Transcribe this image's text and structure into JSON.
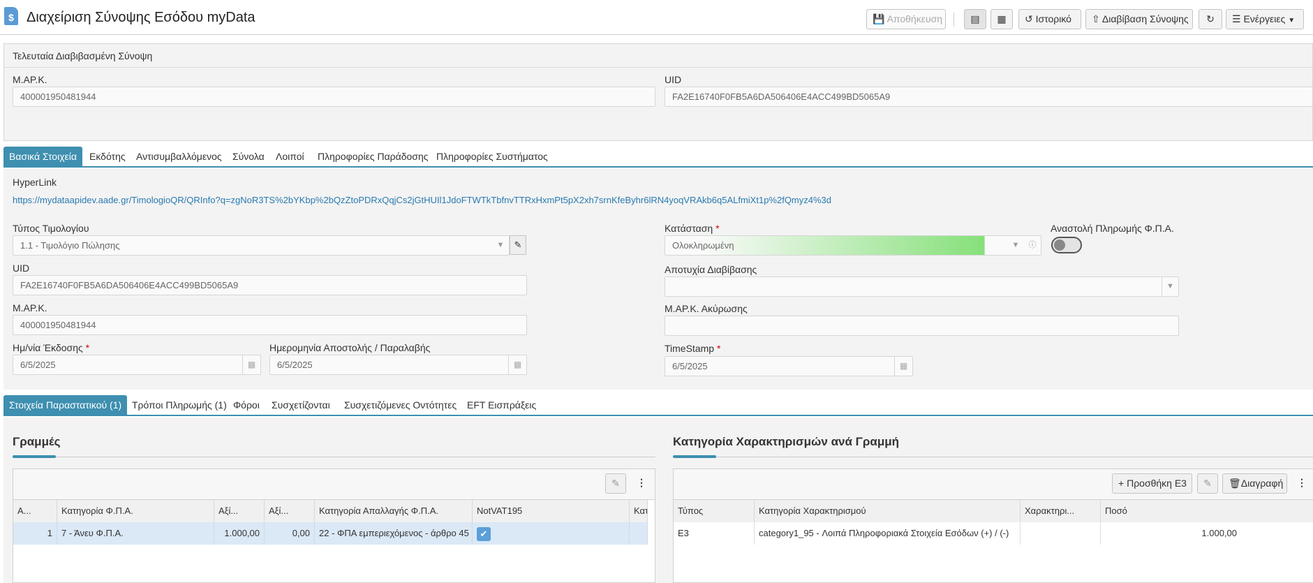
{
  "header": {
    "title": "Διαχείριση Σύνοψης Εσόδου myData",
    "doc_icon_glyph": "$",
    "save_label": "Αποθήκευση",
    "history_label": "Ιστορικό",
    "transmit_label": "Διαβίβαση Σύνοψης",
    "actions_label": "Ενέργειες"
  },
  "last_summary": {
    "title": "Τελευταία Διαβιβασμένη Σύνοψη",
    "mark_label": "Μ.ΑΡ.Κ.",
    "mark_value": "400001950481944",
    "uid_label": "UID",
    "uid_value": "FA2E16740F0FB5A6DA506406E4ACC499BD5065A9"
  },
  "main_tabs": [
    "Βασικά Στοιχεία",
    "Εκδότης",
    "Αντισυμβαλλόμενος",
    "Σύνολα",
    "Λοιποί",
    "Πληροφορίες Παράδοσης",
    "Πληροφορίες Συστήματος"
  ],
  "basic": {
    "hyperlink_label": "HyperLink",
    "hyperlink_value": "https://mydataapidev.aade.gr/TimologioQR/QRInfo?q=zgNoR3TS%2bYKbp%2bQzZtoPDRxQqjCs2jGtHUIl1JdoFTWTkTbfnvTTRxHxmPt5pX2xh7srnKfeByhr6lRN4yoqVRAkb6q5ALfmiXt1p%2fQmyz4%3d",
    "invoice_type_label": "Τύπος Τιμολογίου",
    "invoice_type_value": "1.1 - Τιμολόγιο Πώλησης",
    "status_label": "Κατάσταση",
    "status_value": "Ολοκληρωμένη",
    "vat_suspension_label": "Αναστολή Πληρωμής Φ.Π.Α.",
    "uid_label": "UID",
    "uid_value": "FA2E16740F0FB5A6DA506406E4ACC499BD5065A9",
    "transmit_failure_label": "Αποτυχία Διαβίβασης",
    "mark_label": "Μ.ΑΡ.Κ.",
    "mark_value": "400001950481944",
    "cancel_mark_label": "Μ.ΑΡ.Κ. Ακύρωσης",
    "issue_date_label": "Ημ/νία Έκδοσης",
    "issue_date_value": "6/5/2025",
    "dispatch_date_label": "Ημερομηνία Αποστολής / Παραλαβής",
    "dispatch_date_value": "6/5/2025",
    "timestamp_label": "TimeStamp",
    "timestamp_value": "6/5/2025",
    "required_mark": "*"
  },
  "sub_tabs": [
    "Στοιχεία Παραστατικού (1)",
    "Τρόποι Πληρωμής (1)",
    "Φόροι",
    "Συσχετίζονται",
    "Συσχετιζόμενες Οντότητες",
    "EFT Εισπράξεις"
  ],
  "lines": {
    "title": "Γραμμές",
    "columns": [
      "Α...",
      "Κατηγορία Φ.Π.Α.",
      "Αξί...",
      "Αξί...",
      "Κατηγορία Απαλλαγής Φ.Π.Α.",
      "NotVAT195",
      "Κατ"
    ],
    "rows": [
      {
        "aa": "1",
        "vat_category": "7 - Άνευ Φ.Π.Α.",
        "value1": "1.000,00",
        "value2": "0,00",
        "exemption": "22 - ΦΠΑ εμπεριεχόμενος - άρθρο 45",
        "notvat195": true
      }
    ]
  },
  "classifications": {
    "title": "Κατηγορία Χαρακτηρισμών ανά Γραμμή",
    "add_label": "Προσθήκη Ε3",
    "delete_label": "Διαγραφή",
    "columns": [
      "Τύπος",
      "Κατηγορία Χαρακτηρισμού",
      "Χαρακτηρι...",
      "Ποσό"
    ],
    "rows": [
      {
        "type": "E3",
        "category": "category1_95 - Λοιπά Πληροφοριακά Στοιχεία Εσόδων (+) / (-)",
        "char": "",
        "amount": "1.000,00"
      }
    ]
  },
  "colors": {
    "accent": "#3e8fb0",
    "status_gradient_end": "#86e07a"
  }
}
